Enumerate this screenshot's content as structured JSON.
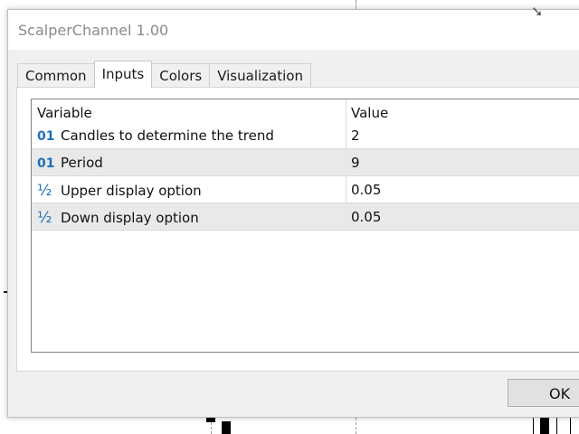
{
  "window": {
    "title": "ScalperChannel 1.00"
  },
  "tabs": [
    {
      "label": "Common",
      "active": false
    },
    {
      "label": "Inputs",
      "active": true
    },
    {
      "label": "Colors",
      "active": false
    },
    {
      "label": "Visualization",
      "active": false
    }
  ],
  "inputs_table": {
    "headers": {
      "variable": "Variable",
      "value": "Value"
    },
    "rows": [
      {
        "icon": "integer-type-icon",
        "glyph": "01",
        "variable": "Candles to determine the trend",
        "value": "2"
      },
      {
        "icon": "integer-type-icon",
        "glyph": "01",
        "variable": "Period",
        "value": "9"
      },
      {
        "icon": "double-type-icon",
        "glyph": "½",
        "variable": "Upper display option",
        "value": "0.05"
      },
      {
        "icon": "double-type-icon",
        "glyph": "½",
        "variable": "Down display option",
        "value": "0.05"
      }
    ]
  },
  "buttons": {
    "ok_label": "OK"
  },
  "colors": {
    "type_icon": "#1f6fb8",
    "shaded_row": "#e9e9e9",
    "dialog_bg": "#f0f0f0"
  }
}
